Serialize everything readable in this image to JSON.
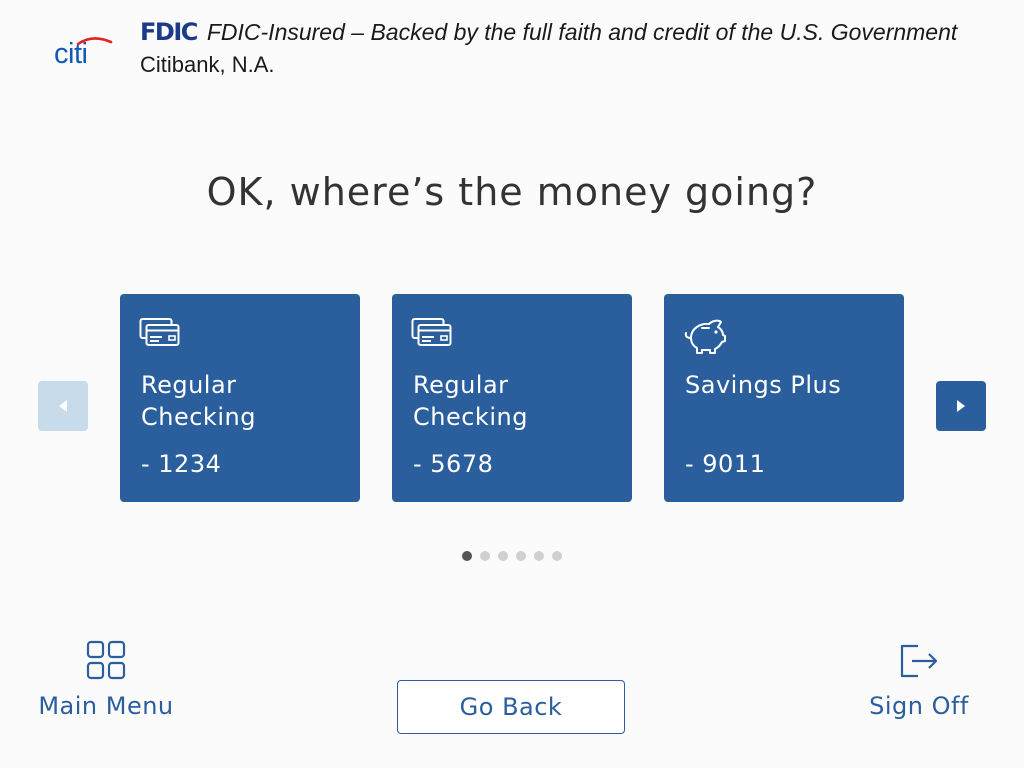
{
  "header": {
    "logo": "citi",
    "fdic_mark": "FDIC",
    "fdic_text": "FDIC-Insured – Backed by the full faith and credit of the U.S. Government",
    "bank_name": "Citibank, N.A."
  },
  "main": {
    "title": "OK, where’s the money going?",
    "accounts": [
      {
        "icon": "credit-cards-icon",
        "name": "Regular Checking",
        "number": "- 1234"
      },
      {
        "icon": "credit-cards-icon",
        "name": "Regular Checking",
        "number": "- 5678"
      },
      {
        "icon": "piggy-bank-icon",
        "name": "Savings Plus",
        "number": "- 9011"
      }
    ],
    "pagination": {
      "total": 6,
      "current": 1
    }
  },
  "footer": {
    "main_menu_label": "Main Menu",
    "go_back_label": "Go Back",
    "sign_off_label": "Sign Off"
  },
  "colors": {
    "brand_blue": "#2b5e9d",
    "disabled_arrow": "#c8dbea",
    "citi_blue": "#0f5ab8",
    "citi_red": "#e3231f",
    "fdic_navy": "#1b3a8a",
    "background": "#fbfbfb"
  }
}
